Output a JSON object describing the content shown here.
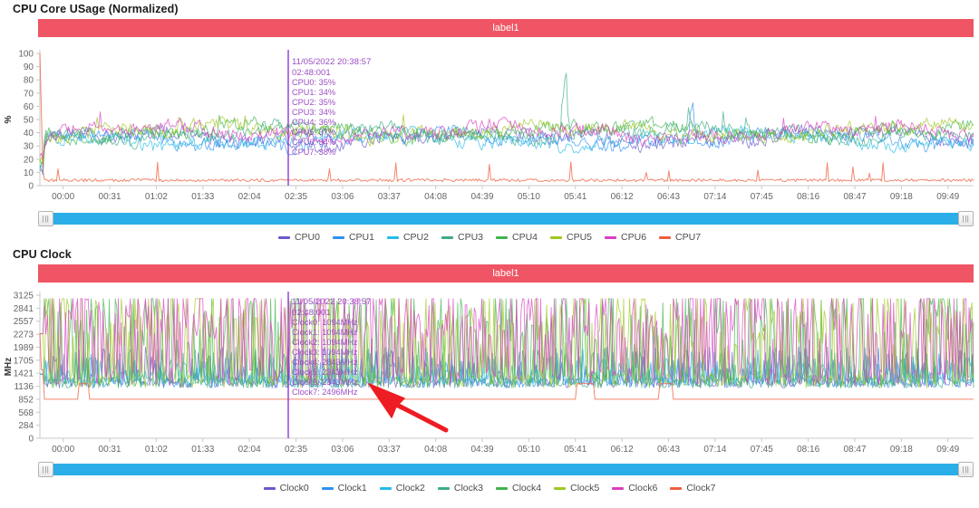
{
  "charts": [
    {
      "title": "CPU Core USage (Normalized)",
      "label_bar": "label1",
      "ylabel": "%",
      "yticks": [
        "100",
        "90",
        "80",
        "70",
        "60",
        "50",
        "40",
        "30",
        "20",
        "10",
        "0"
      ],
      "ymin": 0,
      "ymax": 100,
      "xticks": [
        "00:00",
        "00:31",
        "01:02",
        "01:33",
        "02:04",
        "02:35",
        "03:06",
        "03:37",
        "04:08",
        "04:39",
        "05:10",
        "05:41",
        "06:12",
        "06:43",
        "07:14",
        "07:45",
        "08:16",
        "08:47",
        "09:18",
        "09:49"
      ],
      "tooltip": {
        "date": "11/05/2022 20:38:57",
        "time": "02:48:001",
        "rows": [
          "CPU0: 35%",
          "CPU1: 34%",
          "CPU2: 35%",
          "CPU3: 34%",
          "CPU4: 36%",
          "CPU5: 37%",
          "CPU6: 34%",
          "CPU7: 38%"
        ]
      },
      "legend": [
        {
          "label": "CPU0",
          "color": "#6a5acd"
        },
        {
          "label": "CPU1",
          "color": "#2e92f0"
        },
        {
          "label": "CPU2",
          "color": "#25bbe8"
        },
        {
          "label": "CPU3",
          "color": "#3cab86"
        },
        {
          "label": "CPU4",
          "color": "#3fb44c"
        },
        {
          "label": "CPU5",
          "color": "#9ec81e"
        },
        {
          "label": "CPU6",
          "color": "#d93fc0"
        },
        {
          "label": "CPU7",
          "color": "#ef5e3b"
        }
      ],
      "scrollbar": {
        "left_grip": "|||",
        "right_grip": "|||"
      }
    },
    {
      "title": "CPU Clock",
      "label_bar": "label1",
      "ylabel": "MHz",
      "yticks": [
        "3125",
        "2841",
        "2557",
        "2273",
        "1989",
        "1705",
        "1421",
        "1136",
        "852",
        "568",
        "284",
        "0"
      ],
      "ymin": 0,
      "ymax": 3125,
      "xticks": [
        "00:00",
        "00:31",
        "01:02",
        "01:33",
        "02:04",
        "02:35",
        "03:06",
        "03:37",
        "04:08",
        "04:39",
        "05:10",
        "05:41",
        "06:12",
        "06:43",
        "07:14",
        "07:45",
        "08:16",
        "08:47",
        "09:18",
        "09:49"
      ],
      "tooltip": {
        "date": "11/05/2022 20:38:57",
        "time": "02:48:001",
        "rows": [
          "Clock0: 1094MHz",
          "Clock1: 1094MHz",
          "Clock2: 1094MHz",
          "Clock3: 1094MHz",
          "Clock4: 2843MHz",
          "Clock5: 2343MHz",
          "Clock6: 2343MHz",
          "Clock7: 2496MHz"
        ]
      },
      "legend": [
        {
          "label": "Clock0",
          "color": "#6a5acd"
        },
        {
          "label": "Clock1",
          "color": "#2e92f0"
        },
        {
          "label": "Clock2",
          "color": "#25bbe8"
        },
        {
          "label": "Clock3",
          "color": "#3cab86"
        },
        {
          "label": "Clock4",
          "color": "#3fb44c"
        },
        {
          "label": "Clock5",
          "color": "#9ec81e"
        },
        {
          "label": "Clock6",
          "color": "#d93fc0"
        },
        {
          "label": "Clock7",
          "color": "#ef5e3b"
        }
      ],
      "scrollbar": {
        "left_grip": "|||",
        "right_grip": "|||"
      },
      "annotation": {
        "type": "arrow",
        "color": "#ee1c23"
      }
    }
  ],
  "chart_data": [
    {
      "type": "line",
      "title": "CPU Core USage (Normalized)",
      "xlabel": "",
      "ylabel": "%",
      "ylim": [
        0,
        100
      ],
      "grid": false,
      "legend_position": "bottom",
      "x_tick_labels": [
        "00:00",
        "00:31",
        "01:02",
        "01:33",
        "02:04",
        "02:35",
        "03:06",
        "03:37",
        "04:08",
        "04:39",
        "05:10",
        "05:41",
        "06:12",
        "06:43",
        "07:14",
        "07:45",
        "08:16",
        "08:47",
        "09:18",
        "09:49"
      ],
      "y_tick_values": [
        0,
        10,
        20,
        30,
        40,
        50,
        60,
        70,
        80,
        90,
        100
      ],
      "cursor": {
        "x_label": "02:48:001",
        "date": "11/05/2022 20:38:57"
      },
      "series": [
        {
          "name": "CPU0",
          "color": "#6a5acd",
          "value_at_cursor": 35,
          "mean": 36,
          "range": [
            5,
            62
          ]
        },
        {
          "name": "CPU1",
          "color": "#2e92f0",
          "value_at_cursor": 34,
          "mean": 35,
          "range": [
            5,
            65
          ]
        },
        {
          "name": "CPU2",
          "color": "#25bbe8",
          "value_at_cursor": 35,
          "mean": 35,
          "range": [
            5,
            64
          ]
        },
        {
          "name": "CPU3",
          "color": "#3cab86",
          "value_at_cursor": 34,
          "mean": 40,
          "range": [
            8,
            92
          ]
        },
        {
          "name": "CPU4",
          "color": "#3fb44c",
          "value_at_cursor": 36,
          "mean": 41,
          "range": [
            8,
            62
          ]
        },
        {
          "name": "CPU5",
          "color": "#9ec81e",
          "value_at_cursor": 37,
          "mean": 41,
          "range": [
            8,
            60
          ]
        },
        {
          "name": "CPU6",
          "color": "#d93fc0",
          "value_at_cursor": 34,
          "mean": 40,
          "range": [
            8,
            58
          ]
        },
        {
          "name": "CPU7",
          "color": "#ef5e3b",
          "value_at_cursor": 38,
          "mean": 4,
          "range": [
            1,
            100
          ]
        }
      ]
    },
    {
      "type": "line",
      "title": "CPU Clock",
      "xlabel": "",
      "ylabel": "MHz",
      "ylim": [
        0,
        3125
      ],
      "grid": false,
      "legend_position": "bottom",
      "x_tick_labels": [
        "00:00",
        "00:31",
        "01:02",
        "01:33",
        "02:04",
        "02:35",
        "03:06",
        "03:37",
        "04:08",
        "04:39",
        "05:10",
        "05:41",
        "06:12",
        "06:43",
        "07:14",
        "07:45",
        "08:16",
        "08:47",
        "09:18",
        "09:49"
      ],
      "y_tick_values": [
        0,
        284,
        568,
        852,
        1136,
        1421,
        1705,
        1989,
        2273,
        2557,
        2841,
        3125
      ],
      "cursor": {
        "x_label": "02:48:001",
        "date": "11/05/2022 20:38:57"
      },
      "series": [
        {
          "name": "Clock0",
          "color": "#6a5acd",
          "value_at_cursor": 1094,
          "mean": 1300,
          "range": [
            900,
            2400
          ]
        },
        {
          "name": "Clock1",
          "color": "#2e92f0",
          "value_at_cursor": 1094,
          "mean": 1300,
          "range": [
            900,
            2400
          ]
        },
        {
          "name": "Clock2",
          "color": "#25bbe8",
          "value_at_cursor": 1094,
          "mean": 1280,
          "range": [
            900,
            2300
          ]
        },
        {
          "name": "Clock3",
          "color": "#3cab86",
          "value_at_cursor": 1094,
          "mean": 1300,
          "range": [
            900,
            2300
          ]
        },
        {
          "name": "Clock4",
          "color": "#3fb44c",
          "value_at_cursor": 2843,
          "mean": 1600,
          "range": [
            900,
            2600
          ]
        },
        {
          "name": "Clock5",
          "color": "#9ec81e",
          "value_at_cursor": 2343,
          "mean": 1600,
          "range": [
            900,
            2600
          ]
        },
        {
          "name": "Clock6",
          "color": "#d93fc0",
          "value_at_cursor": 2343,
          "mean": 1900,
          "range": [
            1100,
            2700
          ]
        },
        {
          "name": "Clock7",
          "color": "#ef5e3b",
          "value_at_cursor": 2496,
          "mean": 880,
          "range": [
            852,
            1500
          ]
        }
      ]
    }
  ]
}
